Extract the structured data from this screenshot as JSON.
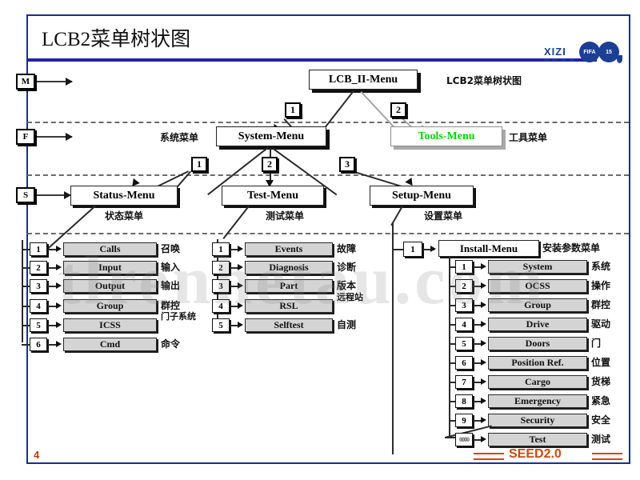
{
  "slide": {
    "title": "LCB2菜单树状图",
    "page_number": "4",
    "footer_brand": "SEED2.0",
    "watermark": "tlrenhetau.com",
    "logo": {
      "brand": "XIZI",
      "emblem_left": "FIFA",
      "emblem_right": "15"
    }
  },
  "keys": {
    "main": "M",
    "function": "F",
    "sub": "S"
  },
  "root": {
    "label": "LCB_II-Menu",
    "annotation": "LCB2菜单树状图"
  },
  "level1": {
    "branch_numbers": [
      "1",
      "2"
    ],
    "items": [
      {
        "label": "System-Menu",
        "annotation": "系统菜单",
        "annotation_side": "left"
      },
      {
        "label": "Tools-Menu",
        "annotation": "工具菜单",
        "annotation_side": "right",
        "text_color": "#00d800"
      }
    ]
  },
  "level2": {
    "branch_numbers": [
      "1",
      "2",
      "3"
    ],
    "items": [
      {
        "label": "Status-Menu",
        "annotation": "状态菜单"
      },
      {
        "label": "Test-Menu",
        "annotation": "测试菜单"
      },
      {
        "label": "Setup-Menu",
        "annotation": "设置菜单"
      }
    ]
  },
  "status_children": [
    {
      "num": "1",
      "label": "Calls",
      "annotation": "召唤"
    },
    {
      "num": "2",
      "label": "Input",
      "annotation": "输入"
    },
    {
      "num": "3",
      "label": "Output",
      "annotation": "输出"
    },
    {
      "num": "4",
      "label": "Group",
      "annotation": "群控"
    },
    {
      "num": "5",
      "label": "ICSS",
      "annotation": "门子系统"
    },
    {
      "num": "6",
      "label": "Cmd",
      "annotation": "命令"
    }
  ],
  "test_children": [
    {
      "num": "1",
      "label": "Events",
      "annotation": "故障"
    },
    {
      "num": "2",
      "label": "Diagnosis",
      "annotation": "诊断"
    },
    {
      "num": "3",
      "label": "Part",
      "annotation": "版本"
    },
    {
      "num": "4",
      "label": "RSL",
      "annotation": "远程站"
    },
    {
      "num": "5",
      "label": "Selftest",
      "annotation": "自测"
    }
  ],
  "setup_child": {
    "num": "1",
    "label": "Install-Menu",
    "annotation": "安装参数菜单"
  },
  "install_children": [
    {
      "num": "1",
      "label": "System",
      "annotation": "系统"
    },
    {
      "num": "2",
      "label": "OCSS",
      "annotation": "操作"
    },
    {
      "num": "3",
      "label": "Group",
      "annotation": "群控"
    },
    {
      "num": "4",
      "label": "Drive",
      "annotation": "驱动"
    },
    {
      "num": "5",
      "label": "Doors",
      "annotation": "门"
    },
    {
      "num": "6",
      "label": "Position Ref.",
      "annotation": "位置"
    },
    {
      "num": "7",
      "label": "Cargo",
      "annotation": "货梯"
    },
    {
      "num": "8",
      "label": "Emergency",
      "annotation": "紧急"
    },
    {
      "num": "9",
      "label": "Security",
      "annotation": "安全"
    },
    {
      "num": "0000",
      "label": "Test",
      "annotation": "测试"
    }
  ],
  "colors": {
    "frame": "#1c2d8f",
    "title_rule": "#2222aa",
    "brand_orange": "#d2470a",
    "tools_green": "#00d800",
    "leaf_fill": "#d4d4d4"
  }
}
